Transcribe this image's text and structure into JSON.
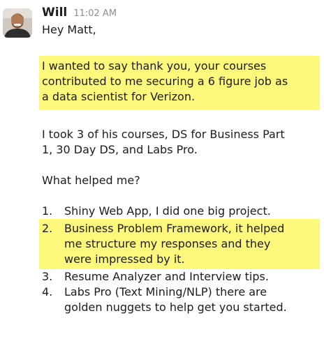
{
  "message": {
    "author": "Will",
    "timestamp": "11:02 AM",
    "greeting": "Hey Matt,",
    "highlight_lines": [
      "I wanted to say thank you, your courses",
      "contributed to me securing a 6 figure job as",
      "a data scientist for Verizon."
    ],
    "paragraph_lines": [
      "I took 3 of his courses, DS for Business Part",
      "1, 30 Day DS, and Labs Pro."
    ],
    "question": "What helped me?",
    "list": [
      {
        "number": "1.",
        "lines": [
          "Shiny Web App, I did one big project."
        ]
      },
      {
        "number": "2.",
        "lines": [
          "Business Problem Framework, it helped",
          "me structure my responses and they",
          "were impressed by it."
        ]
      },
      {
        "number": "3.",
        "lines": [
          "Resume Analyzer and Interview tips."
        ]
      },
      {
        "number": "4.",
        "lines": [
          "Labs Pro (Text Mining/NLP) there are",
          "golden nuggets to help get you started."
        ]
      }
    ]
  },
  "colors": {
    "highlight": "#fbf87c",
    "text": "#1d1c1d",
    "timestamp": "#8e8e8e"
  },
  "icons": {
    "avatar": "user-avatar-photo"
  }
}
